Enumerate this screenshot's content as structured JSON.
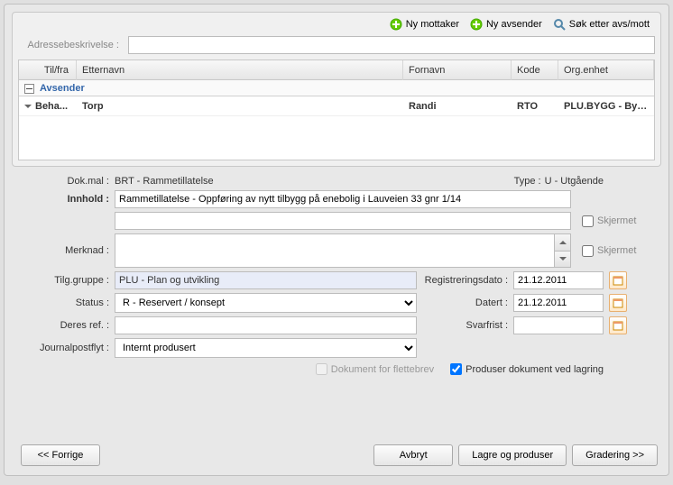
{
  "toolbar": {
    "ny_mottaker": "Ny mottaker",
    "ny_avsender": "Ny avsender",
    "sok": "Søk etter avs/mott"
  },
  "adresse": {
    "label": "Adressebeskrivelse :",
    "value": ""
  },
  "grid": {
    "headers": {
      "tilfra": "Til/fra",
      "etternavn": "Etternavn",
      "fornavn": "Fornavn",
      "kode": "Kode",
      "orgenhet": "Org.enhet"
    },
    "group": "Avsender",
    "row": {
      "tilfra": "Beha...",
      "etternavn": "Torp",
      "fornavn": "Randi",
      "kode": "RTO",
      "orgenhet": "PLU.BYGG - Byg..."
    }
  },
  "form": {
    "dokmal_label": "Dok.mal :",
    "dokmal_value": "BRT - Rammetillatelse",
    "type_label": "Type :",
    "type_value": "U - Utgående",
    "innhold_label": "Innhold :",
    "innhold_value": "Rammetillatelse - Oppføring av nytt tilbygg på enebolig i Lauveien 33 gnr 1/14",
    "innhold2_value": "",
    "skjermet": "Skjermet",
    "merknad_label": "Merknad :",
    "merknad_value": "",
    "tilg_label": "Tilg.gruppe :",
    "tilg_value": "PLU - Plan og utvikling",
    "regdato_label": "Registreringsdato :",
    "regdato_value": "21.12.2011",
    "status_label": "Status :",
    "status_value": "R - Reservert / konsept",
    "datert_label": "Datert :",
    "datert_value": "21.12.2011",
    "deresref_label": "Deres ref. :",
    "deresref_value": "",
    "svarfrist_label": "Svarfrist :",
    "svarfrist_value": "",
    "journal_label": "Journalpostflyt :",
    "journal_value": "Internt produsert",
    "dok_flettebrev": "Dokument for flettebrev",
    "produser_dok": "Produser dokument ved lagring"
  },
  "footer": {
    "forrige": "<< Forrige",
    "avbryt": "Avbryt",
    "lagre": "Lagre og produser",
    "gradering": "Gradering >>"
  }
}
